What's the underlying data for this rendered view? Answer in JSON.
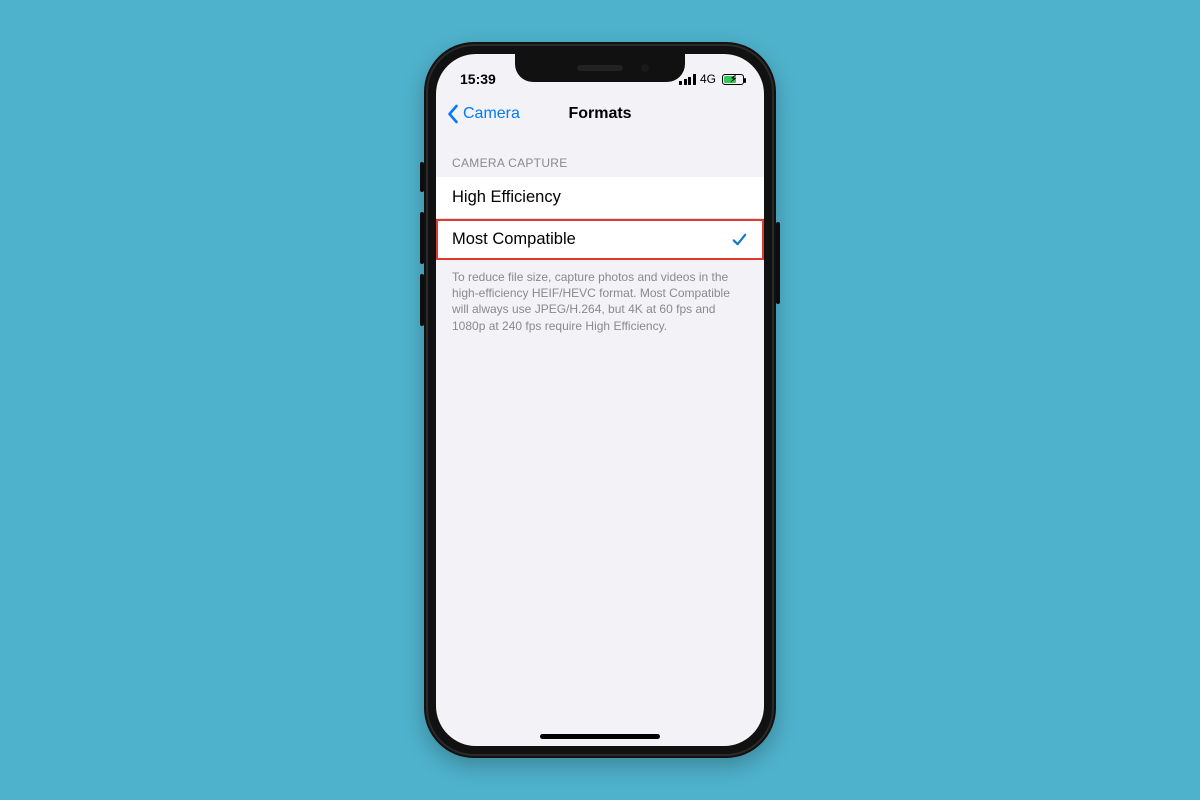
{
  "status": {
    "time": "15:39",
    "network_label": "4G"
  },
  "nav": {
    "back_label": "Camera",
    "title": "Formats"
  },
  "section": {
    "header": "CAMERA CAPTURE",
    "options": [
      {
        "label": "High Efficiency",
        "selected": false,
        "highlighted": false
      },
      {
        "label": "Most Compatible",
        "selected": true,
        "highlighted": true
      }
    ],
    "footer": "To reduce file size, capture photos and videos in the high-efficiency HEIF/HEVC format. Most Compatible will always use JPEG/H.264, but 4K at 60 fps and 1080p at 240 fps require High Efficiency."
  }
}
